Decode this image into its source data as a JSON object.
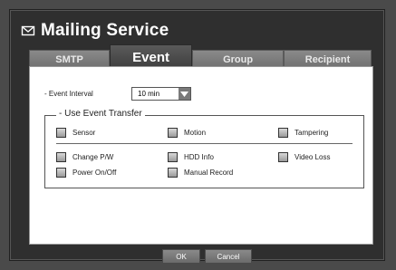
{
  "window": {
    "title": "Mailing Service",
    "icon": "envelope-icon"
  },
  "tabs": [
    {
      "label": "SMTP",
      "active": false
    },
    {
      "label": "Event",
      "active": true
    },
    {
      "label": "Group",
      "active": false
    },
    {
      "label": "Recipient",
      "active": false
    }
  ],
  "event_interval": {
    "label": "- Event Interval",
    "value": "10 min"
  },
  "use_event_transfer": {
    "title": "- Use Event Transfer",
    "items": [
      {
        "label": "Sensor",
        "checked": false
      },
      {
        "label": "Motion",
        "checked": false
      },
      {
        "label": "Tampering",
        "checked": false
      },
      {
        "label": "Change P/W",
        "checked": false
      },
      {
        "label": "HDD Info",
        "checked": false
      },
      {
        "label": "Video Loss",
        "checked": false
      },
      {
        "label": "Power On/Off",
        "checked": false
      },
      {
        "label": "Manual Record",
        "checked": false
      }
    ]
  },
  "buttons": {
    "ok": "OK",
    "cancel": "Cancel"
  },
  "colors": {
    "background": "#4a4a4a",
    "window": "#2f2f2f",
    "panel": "#ffffff",
    "tab": "#7a7a7a"
  }
}
